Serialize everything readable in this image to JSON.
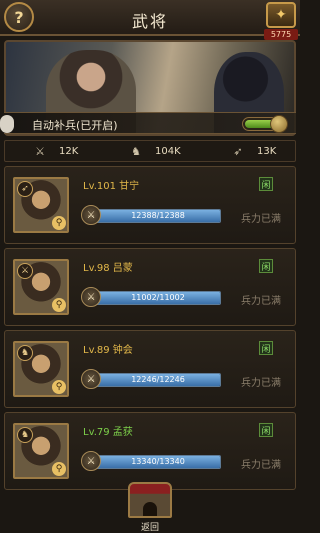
{
  "header": {
    "help_icon": "?",
    "title": "武将",
    "resource_count": "5775"
  },
  "banner": {
    "supply_label": "自动补兵(已开启)",
    "toggle_on": true,
    "toggle_level": 0.75
  },
  "stats": [
    {
      "icon": "sword-icon",
      "value": "12K"
    },
    {
      "icon": "horse-icon",
      "value": "104K"
    },
    {
      "icon": "bow-icon",
      "value": "13K"
    }
  ],
  "heroes": [
    {
      "name": "Lv.101 甘宁",
      "status": "闲",
      "troops": "12388/12388",
      "fill": 1.0,
      "label": "兵力已满",
      "name_color": "gold"
    },
    {
      "name": "Lv.98 吕蒙",
      "status": "闲",
      "troops": "11002/11002",
      "fill": 1.0,
      "label": "兵力已满",
      "name_color": "gold"
    },
    {
      "name": "Lv.89 钟会",
      "status": "闲",
      "troops": "12246/12246",
      "fill": 1.0,
      "label": "兵力已满",
      "name_color": "gold"
    },
    {
      "name": "Lv.79 孟获",
      "status": "闲",
      "troops": "13340/13340",
      "fill": 1.0,
      "label": "兵力已满",
      "name_color": "green"
    }
  ],
  "footer": {
    "back_label": "返回"
  }
}
